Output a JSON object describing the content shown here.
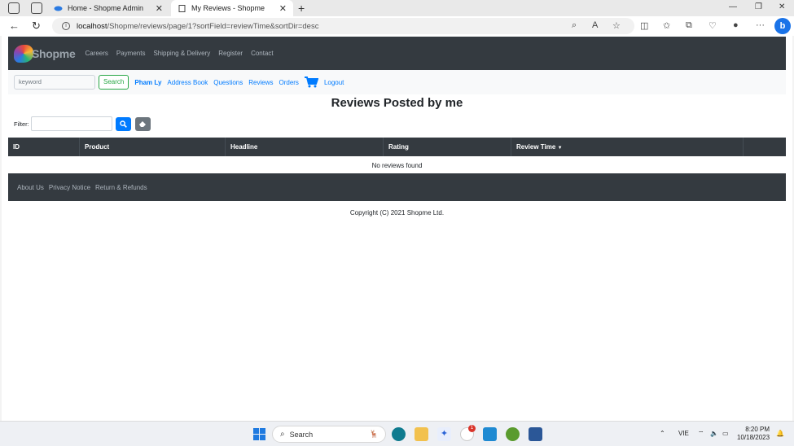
{
  "browser": {
    "tabs": [
      {
        "label": "Home - Shopme Admin"
      },
      {
        "label": "My Reviews - Shopme"
      }
    ],
    "url_host": "localhost",
    "url_path": "/Shopme/reviews/page/1?sortField=reviewTime&sortDir=desc"
  },
  "site": {
    "logo_text": "Shopme",
    "top_nav": [
      "Careers",
      "Payments",
      "Shipping & Delivery",
      "Register",
      "Contact"
    ],
    "search_placeholder": "keyword",
    "search_button": "Search",
    "user_name": "Pham Ly",
    "user_nav": [
      "Address Book",
      "Questions",
      "Reviews",
      "Orders"
    ],
    "logout": "Logout"
  },
  "page": {
    "title": "Reviews Posted by me",
    "filter_label": "Filter:",
    "filter_value": "",
    "table": {
      "columns": [
        "ID",
        "Product",
        "Headline",
        "Rating",
        "Review Time"
      ],
      "sorted_column": "Review Time",
      "sort_dir": "desc",
      "empty_text": "No reviews found"
    }
  },
  "footer": {
    "links": [
      "About Us",
      "Privacy Notice",
      "Return & Refunds"
    ],
    "copyright": "Copyright (C) 2021 Shopme Ltd."
  },
  "taskbar": {
    "search_label": "Search",
    "notification_badge": "1",
    "language": "VIE",
    "time": "8:20 PM",
    "date": "10/18/2023"
  },
  "colors": {
    "dark_bar": "#343a40",
    "link_blue": "#007bff",
    "search_green": "#28a745"
  }
}
